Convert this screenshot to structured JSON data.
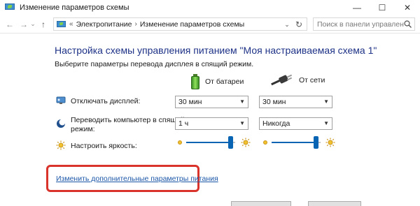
{
  "window": {
    "title": "Изменение параметров схемы",
    "controls": [
      "—",
      "☐",
      "✕"
    ]
  },
  "nav": {
    "back_glyph": "←",
    "forward_glyph": "→",
    "recent_glyph": "⌄",
    "up_glyph": "↑"
  },
  "address": {
    "prefix": "«",
    "breadcrumb": [
      "Электропитание",
      "Изменение параметров схемы"
    ],
    "separator": "›",
    "dropdown_glyph": "⌄",
    "refresh_glyph": "↻"
  },
  "search": {
    "placeholder": "Поиск в панели управления"
  },
  "main": {
    "heading": "Настройка схемы управления питанием \"Моя настраиваемая схема 1\"",
    "subheading": "Выберите параметры перевода дисплея в спящий режим.",
    "columns": {
      "battery": "От батареи",
      "ac": "От сети"
    },
    "rows": {
      "display_off": {
        "label": "Отключать дисплей:",
        "battery_value": "30 мин",
        "ac_value": "30 мин"
      },
      "sleep": {
        "label_line1": "Переводить компьютер в спящий",
        "label_line2": "режим:",
        "battery_value": "1 ч",
        "ac_value": "Никогда"
      },
      "brightness": {
        "label": "Настроить яркость:",
        "battery_level": 0.95,
        "ac_level": 0.95
      }
    },
    "advanced_link": "Изменить дополнительные параметры питания"
  },
  "colors": {
    "heading": "#1e3287",
    "link": "#1c57a8",
    "slider": "#0a64b4",
    "highlight": "#d9332b"
  }
}
